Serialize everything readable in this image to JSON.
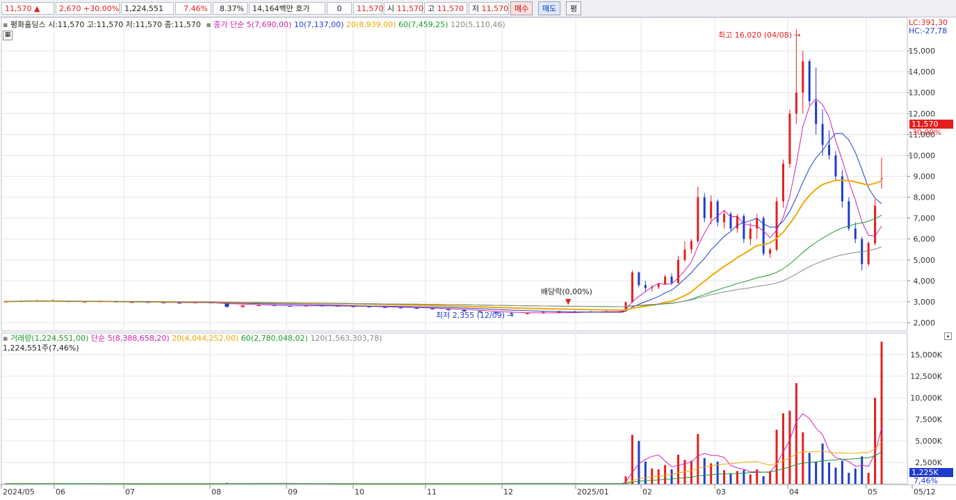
{
  "topbar": {
    "price": "11,570",
    "change": "2,670",
    "change_pct": "+30.00%",
    "volume": "1,224,551",
    "vol_ratio": "7.46%",
    "turnover": "8.37%",
    "amount": "14,164백만",
    "quote_label": "호가",
    "quote_value": "0",
    "quote_price": "11,570",
    "open_label": "시",
    "open": "11,570",
    "high_label": "고",
    "high": "11,570",
    "low_label": "저",
    "low": "11,570",
    "buy_label": "매수",
    "sell_label": "매도",
    "avg_label": "평"
  },
  "price_legend": {
    "stock": "평화홀딩스 시:11,570 고:11,570 저:11,570 종:11,570",
    "ma_label": "종가 단순 5(7,690,00)",
    "ma10": "10(7,137,00)",
    "ma20": "20(8,939,00)",
    "ma60": "60(7,459,25)",
    "ma120": "120(5,110,46)",
    "lc": "LC:391,30",
    "hc": "HC:-27,78"
  },
  "volume_legend": {
    "label": "거래량(1,224,551,00)",
    "ma5": "단순 5(8,388,658,20)",
    "ma20": "20(4,044,252,00)",
    "ma60": "60(2,780,048,02)",
    "ma120": "120(1,563,303,78)",
    "current": "1,224,551주(7,46%)"
  },
  "annotations": {
    "high": "최고 16,020 (04/08)",
    "low": "최저 2,355 (12/09)",
    "dividend": "배당락(0,00%)"
  },
  "price_tags": {
    "current": "11,570",
    "pct": "30,00%",
    "vol_current": "1,225K",
    "vol_pct": "7,46%"
  },
  "colors": {
    "up": "#e41e1e",
    "down": "#1e3cc8",
    "ma5": "#d020b0",
    "ma10": "#1e3cc8",
    "ma20": "#f0a800",
    "ma60": "#1a9a2a",
    "ma120": "#888888",
    "grid": "#e3e5ea"
  },
  "chart_data": [
    {
      "type": "candlestick",
      "y_ticks": [
        "2,000",
        "3,000",
        "4,000",
        "5,000",
        "6,000",
        "7,000",
        "8,000",
        "9,000",
        "10,000",
        "11,000",
        "12,000",
        "13,000",
        "14,000",
        "15,000"
      ],
      "ylim": [
        1600,
        16600
      ],
      "x_ticks": [
        "2024/05",
        "06",
        "07",
        "08",
        "09",
        "10",
        "11",
        "12",
        "2025/01",
        "02",
        "03",
        "04",
        "05",
        "05/12"
      ],
      "series_ohlc": [
        [
          3000,
          3050,
          2960,
          3010
        ],
        [
          3010,
          3080,
          2980,
          3030
        ],
        [
          3030,
          3100,
          3000,
          3060
        ],
        [
          3060,
          3120,
          3010,
          3020
        ],
        [
          3020,
          3060,
          2980,
          2990
        ],
        [
          2990,
          3030,
          2950,
          3000
        ],
        [
          3000,
          3050,
          2970,
          3010
        ],
        [
          3010,
          3040,
          2960,
          2970
        ],
        [
          2970,
          3010,
          2940,
          2980
        ],
        [
          2980,
          3020,
          2950,
          2960
        ],
        [
          2960,
          3000,
          2930,
          2950
        ],
        [
          2950,
          2990,
          2910,
          2940
        ],
        [
          2940,
          2980,
          2920,
          2960
        ],
        [
          2960,
          3000,
          2930,
          2950
        ],
        [
          2950,
          2980,
          2700,
          2760
        ],
        [
          2760,
          2850,
          2700,
          2820
        ],
        [
          2820,
          2870,
          2780,
          2830
        ],
        [
          2830,
          2860,
          2780,
          2800
        ],
        [
          2800,
          2840,
          2760,
          2790
        ],
        [
          2790,
          2830,
          2760,
          2810
        ],
        [
          2810,
          2850,
          2780,
          2800
        ],
        [
          2800,
          2840,
          2770,
          2780
        ],
        [
          2780,
          2820,
          2740,
          2770
        ],
        [
          2770,
          2800,
          2720,
          2740
        ],
        [
          2740,
          2780,
          2700,
          2720
        ],
        [
          2720,
          2760,
          2680,
          2700
        ],
        [
          2700,
          2740,
          2650,
          2680
        ],
        [
          2680,
          2720,
          2620,
          2640
        ],
        [
          2640,
          2680,
          2580,
          2600
        ],
        [
          2600,
          2640,
          2520,
          2540
        ],
        [
          2540,
          2580,
          2480,
          2500
        ],
        [
          2500,
          2540,
          2420,
          2450
        ],
        [
          2450,
          2500,
          2355,
          2420
        ],
        [
          2420,
          2480,
          2380,
          2460
        ],
        [
          2460,
          2530,
          2420,
          2500
        ],
        [
          2500,
          2560,
          2460,
          2520
        ],
        [
          2520,
          2570,
          2480,
          2510
        ],
        [
          2510,
          2560,
          2470,
          2530
        ],
        [
          2530,
          2580,
          2490,
          2540
        ],
        [
          2540,
          2600,
          2500,
          2560
        ],
        [
          2560,
          3000,
          2540,
          2980
        ],
        [
          2980,
          4500,
          2950,
          4400
        ],
        [
          4400,
          4450,
          3700,
          3800
        ],
        [
          3800,
          4000,
          3500,
          3650
        ],
        [
          3650,
          3800,
          3500,
          3700
        ],
        [
          3700,
          3900,
          3600,
          3850
        ],
        [
          3850,
          4300,
          3800,
          4200
        ],
        [
          4200,
          4350,
          3800,
          3900
        ],
        [
          3900,
          5200,
          3850,
          5000
        ],
        [
          5000,
          5900,
          4900,
          5500
        ],
        [
          5500,
          6000,
          5300,
          5900
        ],
        [
          5900,
          8500,
          5800,
          8000
        ],
        [
          8000,
          8200,
          6800,
          7000
        ],
        [
          7000,
          8100,
          6700,
          7800
        ],
        [
          7800,
          7900,
          6600,
          6800
        ],
        [
          6800,
          7400,
          6500,
          7200
        ],
        [
          7200,
          7300,
          6400,
          6500
        ],
        [
          6500,
          7200,
          6300,
          7100
        ],
        [
          7100,
          7200,
          5800,
          6000
        ],
        [
          6000,
          6800,
          5700,
          6500
        ],
        [
          6500,
          7200,
          6000,
          7000
        ],
        [
          7000,
          7100,
          5200,
          5300
        ],
        [
          5300,
          5600,
          5100,
          5500
        ],
        [
          5500,
          8000,
          5400,
          7800
        ],
        [
          7800,
          9800,
          7500,
          9600
        ],
        [
          9600,
          12200,
          9400,
          12000
        ],
        [
          12000,
          16020,
          11500,
          13000
        ],
        [
          13000,
          15000,
          12000,
          14500
        ],
        [
          14500,
          14600,
          12400,
          12600
        ],
        [
          12600,
          14200,
          11000,
          11500
        ],
        [
          11500,
          12200,
          10000,
          10500
        ],
        [
          10500,
          11200,
          9800,
          10000
        ],
        [
          10000,
          10200,
          8800,
          9000
        ],
        [
          9000,
          9300,
          7500,
          7800
        ],
        [
          7800,
          8000,
          6400,
          6500
        ],
        [
          6500,
          6800,
          5800,
          6000
        ],
        [
          6000,
          6100,
          4500,
          4800
        ],
        [
          4800,
          5900,
          4700,
          5800
        ],
        [
          5800,
          7900,
          5700,
          7600
        ],
        [
          8900,
          9900,
          8400,
          8900
        ]
      ],
      "volume_k": [
        40,
        60,
        30,
        50,
        20,
        30,
        25,
        30,
        20,
        25,
        30,
        20,
        25,
        30,
        120,
        60,
        40,
        30,
        25,
        35,
        30,
        20,
        25,
        30,
        20,
        25,
        30,
        35,
        40,
        50,
        45,
        60,
        80,
        50,
        40,
        45,
        40,
        50,
        60,
        70,
        900,
        5700,
        5000,
        2600,
        1800,
        1700,
        2200,
        1700,
        3400,
        2800,
        2700,
        5800,
        3000,
        2400,
        2600,
        1600,
        1200,
        1500,
        1600,
        1100,
        1700,
        900,
        1500,
        6300,
        8200,
        8500,
        11700,
        6000,
        3600,
        2600,
        4700,
        2500,
        1900,
        2700,
        1300,
        1800,
        3200,
        1300,
        10000,
        16500
      ],
      "volume_ylim": [
        0,
        17500
      ],
      "volume_ticks": [
        "2,500K",
        "5,000K",
        "7,500K",
        "10,000K",
        "12,500K",
        "15,000K"
      ]
    }
  ]
}
